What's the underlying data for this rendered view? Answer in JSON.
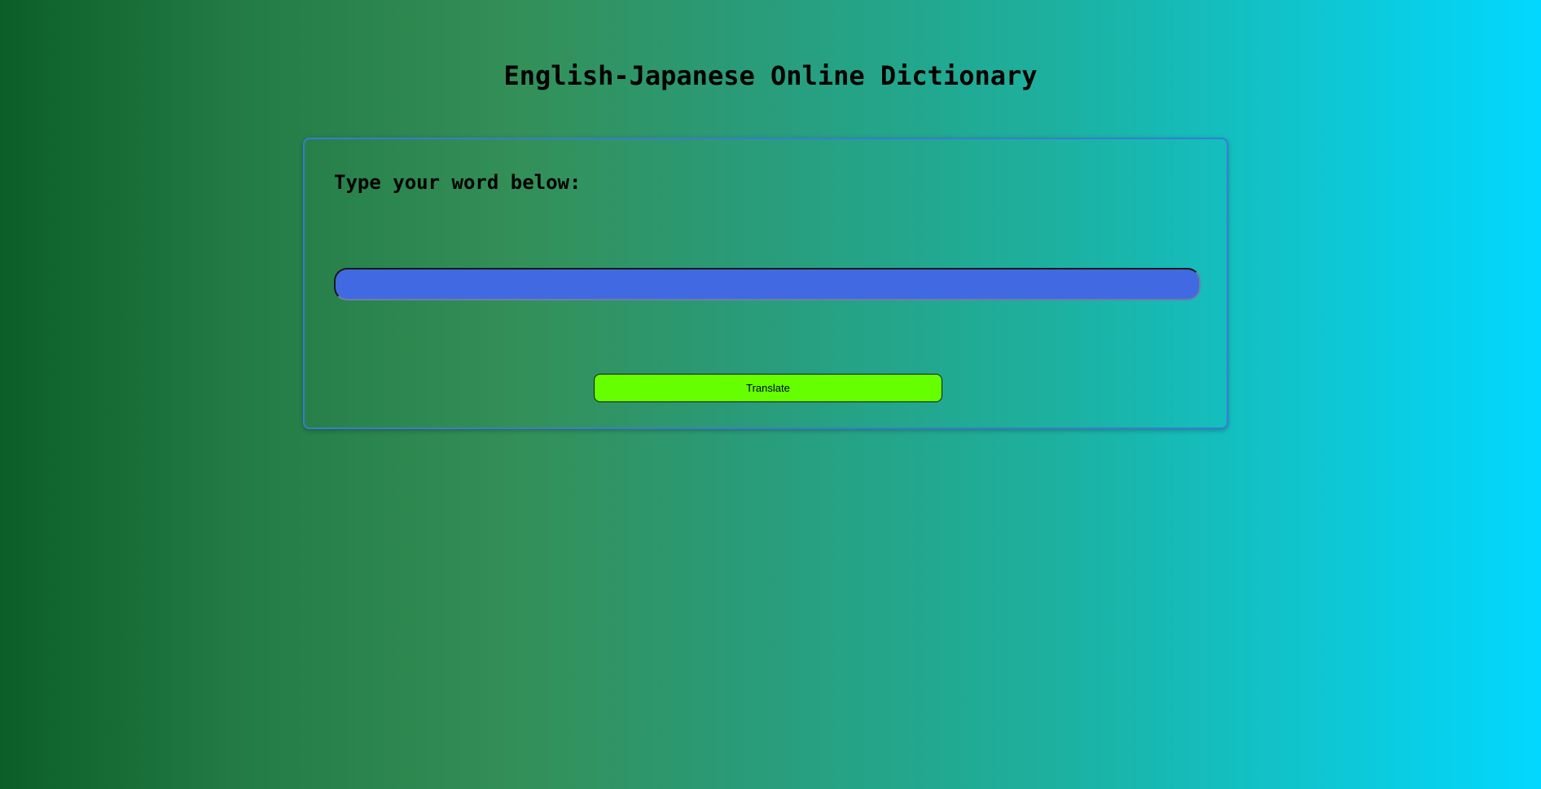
{
  "page": {
    "title": "English-Japanese Online Dictionary"
  },
  "form": {
    "label": "Type your word below:",
    "input_value": "",
    "input_placeholder": "",
    "translate_label": "Translate"
  },
  "colors": {
    "input_background": "#4169e1",
    "button_background": "#66ff00",
    "card_border": "#3a7bd5",
    "gradient_start": "#0b5e28",
    "gradient_end": "#02d8ff"
  }
}
